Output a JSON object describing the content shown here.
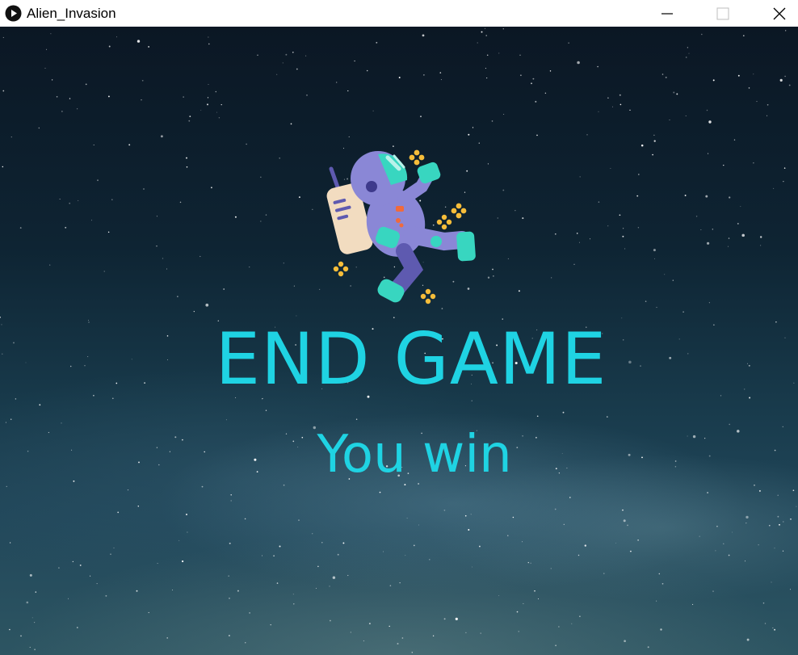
{
  "window": {
    "title": "Alien_Invasion",
    "app_icon": "play-circle-icon",
    "controls": {
      "minimize_icon": "minimize-icon",
      "maximize_icon": "maximize-icon",
      "close_icon": "close-icon"
    }
  },
  "game": {
    "background": "starry-night-sky",
    "sprite": "astronaut-icon",
    "headline": "END GAME",
    "result": "You win",
    "text_color": "#1fd3e3"
  }
}
